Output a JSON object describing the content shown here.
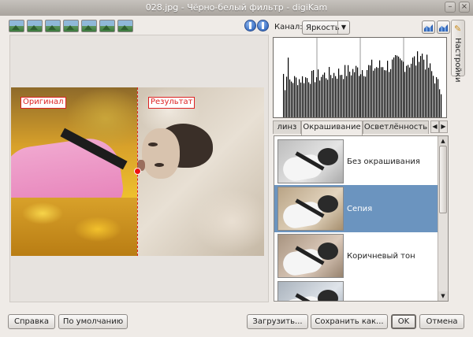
{
  "window": {
    "title": "028.jpg - Чёрно-белый фильтр - digiKam"
  },
  "preview": {
    "original_label": "Оригинал",
    "result_label": "Результат"
  },
  "channel": {
    "label": "Канал:",
    "value": "Яркость"
  },
  "tabs": [
    "линз",
    "Окрашивание",
    "Осветлённость"
  ],
  "filters": [
    {
      "name": "Без окрашивания",
      "selected": false,
      "icon": "grayscale-thumb"
    },
    {
      "name": "Сепия",
      "selected": true,
      "icon": "sepia-thumb"
    },
    {
      "name": "Коричневый тон",
      "selected": false,
      "icon": "brown-thumb"
    },
    {
      "name": "",
      "selected": false,
      "icon": "cold-thumb"
    }
  ],
  "side_tab": {
    "label": "Настройки"
  },
  "buttons": {
    "help": "Справка",
    "defaults": "По умолчанию",
    "load": "Загрузить...",
    "save_as": "Сохранить как...",
    "ok": "OK",
    "cancel": "Отмена"
  },
  "colors": {
    "selection": "#6b94bf",
    "marker": "#dd2222"
  }
}
